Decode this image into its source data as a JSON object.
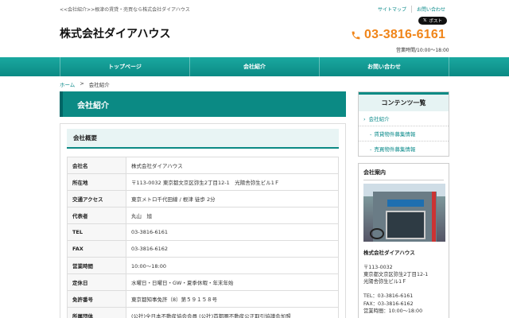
{
  "header": {
    "tagline": "<<会社紹介>>根津の賃貸・売買なら株式会社ダイアハウス",
    "links": [
      "サイトマップ",
      "お問い合わせ"
    ],
    "x_button": "ポスト",
    "logo": "株式会社ダイアハウス",
    "phone": "03-3816-6161",
    "hours": "営業時間/10:00〜18:00"
  },
  "nav": [
    "トップページ",
    "会社紹介",
    "お問い合わせ"
  ],
  "breadcrumb": {
    "home": "ホーム",
    "sep": ">",
    "current": "会社紹介"
  },
  "main": {
    "title": "会社紹介",
    "section": "会社概要",
    "rows": [
      {
        "k": "会社名",
        "v": "株式会社ダイアハウス"
      },
      {
        "k": "所在地",
        "v": "〒113-0032 東京都文京区弥生2丁目12-1　光陽舎弥生ビル1Ｆ"
      },
      {
        "k": "交通アクセス",
        "v": "東京メトロ千代田線 / 根津 徒歩 2分"
      },
      {
        "k": "代表者",
        "v": "丸山　旭"
      },
      {
        "k": "TEL",
        "v": "03-3816-6161"
      },
      {
        "k": "FAX",
        "v": "03-3816-6162"
      },
      {
        "k": "営業時間",
        "v": "10:00〜18:00"
      },
      {
        "k": "定休日",
        "v": "水曜日・日曜日・GW・夏季休暇・年末年始"
      },
      {
        "k": "免許番号",
        "v": "東京都知事免許（8）第５９１５８号"
      },
      {
        "k": "所属団体",
        "v": "(公社)全日本不動産協会会員 (公社)首都圏不動産公正取引協議会加盟"
      }
    ]
  },
  "side": {
    "contents_title": "コンテンツ一覧",
    "links": [
      "会社紹介",
      "賃貸物件募集情報",
      "売買物件募集情報"
    ],
    "company_title": "会社案内",
    "company_name": "株式会社ダイアハウス",
    "info": [
      "〒113-0032",
      "東京都文京区弥生2丁目12-1",
      "光陽舎弥生ビル1Ｆ",
      "",
      "TEL：03-3816-6161",
      "FAX：03-3816-6162",
      "営業時間：10:00〜18:00"
    ]
  },
  "colors": {
    "accent": "#0b8a84",
    "phone": "#f08519"
  }
}
